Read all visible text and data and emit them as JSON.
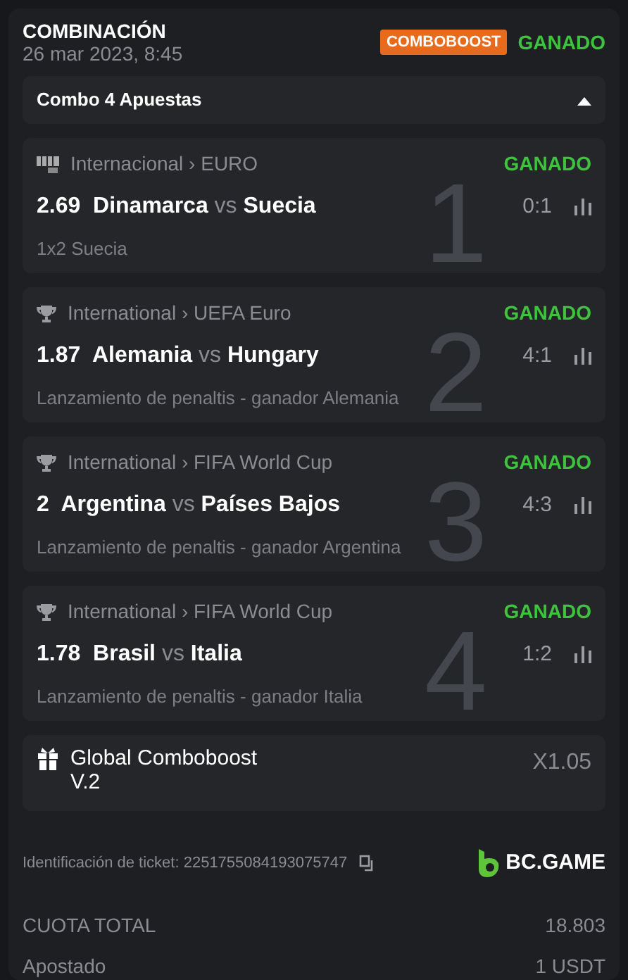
{
  "header": {
    "title": "COMBINACIÓN",
    "date": "26 mar 2023, 8:45",
    "badge": "COMBOBOOST",
    "status": "GANADO"
  },
  "combo": {
    "label": "Combo 4 Apuestas",
    "expanded": true
  },
  "legs": [
    {
      "kind": "fifa",
      "league": "Internacional › EURO",
      "status": "GANADO",
      "odds": "2.69",
      "home": "Dinamarca",
      "vs": "vs",
      "away": "Suecia",
      "score": "0:1",
      "market": "1x2 Suecia",
      "number": "1"
    },
    {
      "kind": "trophy",
      "league": "International › UEFA Euro",
      "status": "GANADO",
      "odds": "1.87",
      "home": "Alemania",
      "vs": "vs",
      "away": "Hungary",
      "score": "4:1",
      "market": "Lanzamiento de penaltis - ganador Alemania",
      "number": "2"
    },
    {
      "kind": "trophy",
      "league": "International › FIFA World Cup",
      "status": "GANADO",
      "odds": "2",
      "home": "Argentina",
      "vs": "vs",
      "away": "Países Bajos",
      "score": "4:3",
      "market": "Lanzamiento de penaltis - ganador Argentina",
      "number": "3"
    },
    {
      "kind": "trophy",
      "league": "International › FIFA World Cup",
      "status": "GANADO",
      "odds": "1.78",
      "home": "Brasil",
      "vs": "vs",
      "away": "Italia",
      "score": "1:2",
      "market": "Lanzamiento de penaltis - ganador Italia",
      "number": "4"
    }
  ],
  "boost": {
    "title": "Global Comboboost",
    "subtitle": "V.2",
    "multiplier": "X1.05"
  },
  "ticket": {
    "label": "Identificación de ticket: 2251755084193075747",
    "brand": "BC.GAME"
  },
  "totals": [
    {
      "label": "CUOTA TOTAL",
      "value": "18.803"
    },
    {
      "label": "Apostado",
      "value": "1 USDT"
    }
  ]
}
